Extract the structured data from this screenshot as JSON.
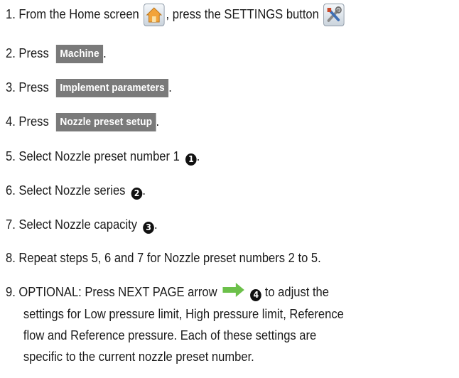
{
  "steps": {
    "s1": {
      "before": "1. From the Home screen",
      "middle": ", press the SETTINGS button"
    },
    "s2": {
      "before": "2. Press",
      "button": "Machine",
      "after": "."
    },
    "s3": {
      "before": "3. Press",
      "button": "Implement parameters",
      "after": "."
    },
    "s4": {
      "before": "4. Press",
      "button": "Nozzle preset setup",
      "after": "."
    },
    "s5": {
      "text": "5. Select Nozzle preset number 1",
      "marker": "1",
      "after": "."
    },
    "s6": {
      "text": "6. Select Nozzle series",
      "marker": "2",
      "after": "."
    },
    "s7": {
      "text": "7. Select Nozzle capacity",
      "marker": "3",
      "after": "."
    },
    "s8": {
      "text": "8. Repeat steps 5, 6 and 7 for Nozzle preset numbers 2 to 5."
    },
    "s9": {
      "before": "9. OPTIONAL: Press NEXT PAGE arrow",
      "marker": "4",
      "line1_end": "to adjust the",
      "line2": "settings for Low pressure limit, High pressure limit, Reference",
      "line3": "flow and Reference pressure. Each of these settings are",
      "line4": "specific to the current nozzle preset number."
    }
  },
  "icons": {
    "home": "home-icon",
    "settings": "settings-tools-icon",
    "next_page": "next-page-arrow-icon"
  },
  "colors": {
    "button_bg": "#7a7a7a",
    "arrow_green": "#6cc04a",
    "home_orange": "#f2a33a"
  }
}
